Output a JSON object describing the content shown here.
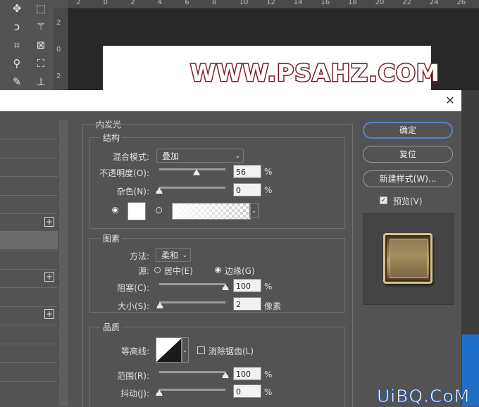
{
  "rulers": {
    "top_ticks": [
      "2",
      "0",
      "2",
      "4",
      "6",
      "8",
      "10",
      "12",
      "14",
      "16",
      "18",
      "20",
      "22",
      "24",
      "26"
    ],
    "left_ticks": [
      "2",
      "0",
      "2"
    ]
  },
  "canvas": {
    "text": "WWW.PSAHZ.COM"
  },
  "tools": [
    {
      "icon": "move-icon",
      "glyph": "✥"
    },
    {
      "icon": "marquee-icon",
      "glyph": "⬚"
    },
    {
      "icon": "lasso-icon",
      "glyph": "ↄ"
    },
    {
      "icon": "magic-wand-icon",
      "glyph": "⚚"
    },
    {
      "icon": "crop-icon",
      "glyph": "⌗"
    },
    {
      "icon": "frame-icon",
      "glyph": "⊠"
    },
    {
      "icon": "eyedropper-icon",
      "glyph": "⚲"
    },
    {
      "icon": "patch-icon",
      "glyph": "⛶"
    },
    {
      "icon": "brush-icon",
      "glyph": "✎"
    },
    {
      "icon": "stamp-icon",
      "glyph": "⊥"
    }
  ],
  "dialog": {
    "close_glyph": "✕",
    "panel_title": "内发光",
    "structure": {
      "title": "结构",
      "blend_mode_label": "混合模式:",
      "blend_mode_value": "叠加",
      "opacity_label": "不透明度(O):",
      "opacity_value": "56",
      "opacity_fraction": 0.56,
      "noise_label": "杂色(N):",
      "noise_value": "0",
      "noise_fraction": 0,
      "percent": "%"
    },
    "elements": {
      "title": "图素",
      "method_label": "方法:",
      "method_value": "柔和",
      "source_label": "源:",
      "source_center": "居中(E)",
      "source_edge": "边缘(G)",
      "choke_label": "阻塞(C):",
      "choke_value": "100",
      "choke_fraction": 1.0,
      "size_label": "大小(S):",
      "size_value": "2",
      "size_fraction": 0.01,
      "size_unit": "像素",
      "percent": "%"
    },
    "quality": {
      "title": "品质",
      "contour_label": "等高线:",
      "antialias_label": "消除锯齿(L)",
      "range_label": "范围(R):",
      "range_value": "100",
      "range_fraction": 1.0,
      "jitter_label": "抖动(J):",
      "jitter_value": "0",
      "jitter_fraction": 0,
      "percent": "%"
    },
    "buttons": {
      "ok": "确定",
      "reset": "复位",
      "new_style": "新建样式(W)...",
      "preview_label": "预览(V)",
      "preview_checked": true
    },
    "list_plus": "+"
  },
  "watermark": "UiBQ.CoM"
}
